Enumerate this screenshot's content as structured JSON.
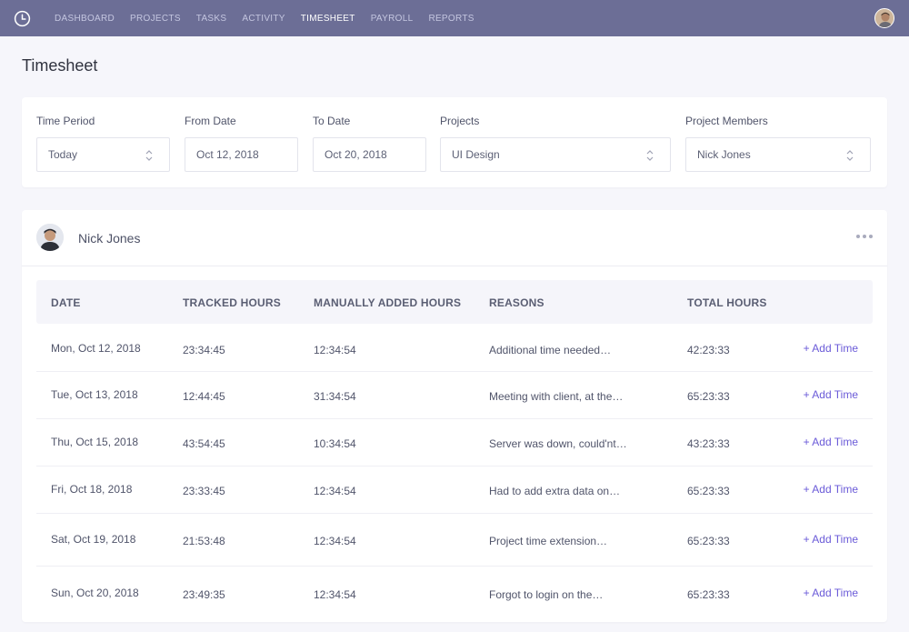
{
  "nav": {
    "items": [
      "DASHBOARD",
      "PROJECTS",
      "TASKS",
      "ACTIVITY",
      "TIMESHEET",
      "PAYROLL",
      "REPORTS"
    ],
    "active": "TIMESHEET"
  },
  "page": {
    "title": "Timesheet"
  },
  "filters": {
    "time_period": {
      "label": "Time Period",
      "value": "Today"
    },
    "from_date": {
      "label": "From Date",
      "value": "Oct 12, 2018"
    },
    "to_date": {
      "label": "To Date",
      "value": "Oct 20, 2018"
    },
    "projects": {
      "label": "Projects",
      "value": "UI Design"
    },
    "members": {
      "label": "Project Members",
      "value": "Nick Jones"
    }
  },
  "member": {
    "name": "Nick Jones"
  },
  "table": {
    "columns": [
      "DATE",
      "TRACKED HOURS",
      "MANUALLY ADDED HOURS",
      "REASONS",
      "TOTAL HOURS"
    ],
    "action_label": "+ Add Time",
    "rows": [
      {
        "date": "Mon, Oct 12, 2018",
        "tracked": "23:34:45",
        "manual": "12:34:54",
        "reason": "Additional time needed…",
        "total": "42:23:33"
      },
      {
        "date": "Tue, Oct 13, 2018",
        "tracked": "12:44:45",
        "manual": "31:34:54",
        "reason": "Meeting with client, at the…",
        "total": "65:23:33"
      },
      {
        "date": "Thu, Oct 15, 2018",
        "tracked": "43:54:45",
        "manual": "10:34:54",
        "reason": "Server was down, could'nt…",
        "total": "43:23:33"
      },
      {
        "date": "Fri, Oct 18, 2018",
        "tracked": "23:33:45",
        "manual": "12:34:54",
        "reason": "Had to add extra data on…",
        "total": "65:23:33"
      },
      {
        "date": "Sat, Oct 19, 2018",
        "tracked": "21:53:48",
        "manual": "12:34:54",
        "reason": "Project time extension…",
        "total": "65:23:33"
      },
      {
        "date": "Sun, Oct 20, 2018",
        "tracked": "23:49:35",
        "manual": "12:34:54",
        "reason": "Forgot to login on the…",
        "total": "65:23:33"
      }
    ]
  },
  "colors": {
    "topbar": "#6c6e96",
    "accent": "#6a5ad8",
    "background": "#f6f6fb"
  }
}
